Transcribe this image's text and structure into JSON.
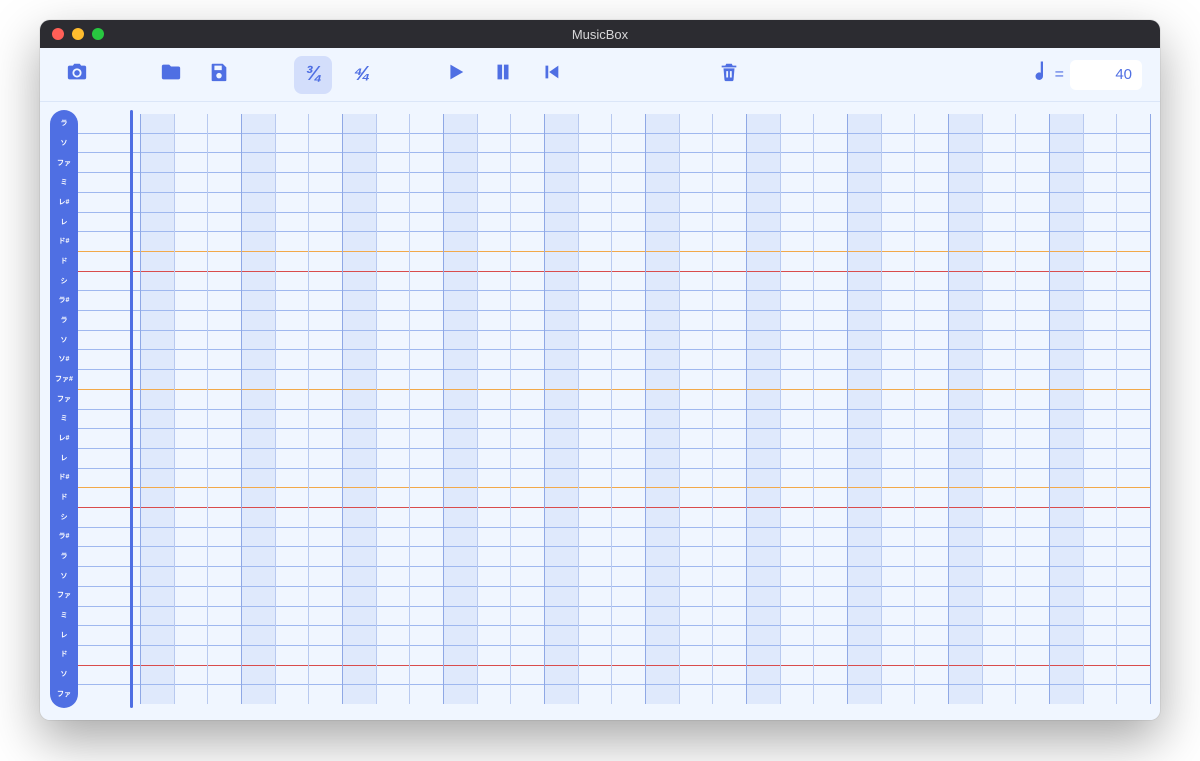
{
  "window": {
    "title": "MusicBox"
  },
  "toolbar": {
    "ts_34": "¾",
    "ts_44": "⁴⁄₄",
    "active_ts": "34",
    "tempo_eq": "=",
    "tempo_value": "40"
  },
  "notes": [
    "ラ",
    "ソ",
    "ファ",
    "ミ",
    "レ#",
    "レ",
    "ド#",
    "ド",
    "シ",
    "ラ#",
    "ラ",
    "ソ",
    "ソ#",
    "ファ#",
    "ファ",
    "ミ",
    "レ#",
    "レ",
    "ド#",
    "ド",
    "シ",
    "ラ#",
    "ラ",
    "ソ",
    "ファ",
    "ミ",
    "レ",
    "ド",
    "ソ",
    "ファ"
  ],
  "row_colors": [
    "blue",
    "blue",
    "blue",
    "blue",
    "blue",
    "blue",
    "orange",
    "red",
    "blue",
    "blue",
    "blue",
    "blue",
    "blue",
    "orange",
    "blue",
    "blue",
    "blue",
    "blue",
    "orange",
    "red",
    "blue",
    "blue",
    "blue",
    "blue",
    "blue",
    "blue",
    "blue",
    "red",
    "blue",
    "blue"
  ],
  "grid": {
    "beats_per_measure": 3,
    "measures": 10,
    "shade_pattern": [
      1,
      0,
      0
    ]
  }
}
